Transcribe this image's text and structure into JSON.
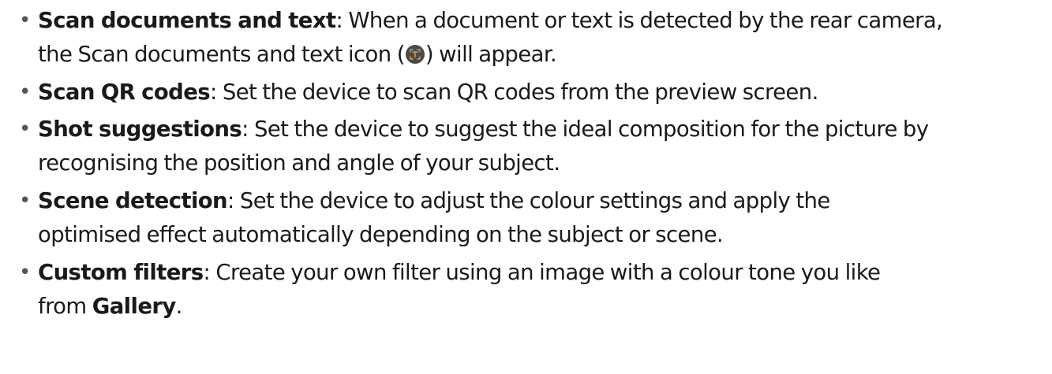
{
  "items": [
    {
      "term": "Scan documents and text",
      "sep": ": ",
      "line1": "When a document or text is detected by the rear camera,",
      "line2_pre": "the Scan documents and text icon (",
      "icon": "scan-text-icon",
      "line2_post": ") will appear."
    },
    {
      "term": "Scan QR codes",
      "sep": ": ",
      "line1": "Set the device to scan QR codes from the preview screen."
    },
    {
      "term": "Shot suggestions",
      "sep": ": ",
      "line1": "Set the device to suggest the ideal composition for the picture by",
      "line2": "recognising the position and angle of your subject."
    },
    {
      "term": "Scene detection",
      "sep": ": ",
      "line1": "Set the device to adjust the colour settings and apply the",
      "line2": "optimised effect automatically depending on the subject or scene."
    },
    {
      "term": "Custom filters",
      "sep": ": ",
      "line1": "Create your own filter using an image with a colour tone you like",
      "line2_pre": "from ",
      "line2_bold": "Gallery",
      "line2_post": "."
    }
  ],
  "bullet": "•",
  "icon_color": "#d9a441"
}
